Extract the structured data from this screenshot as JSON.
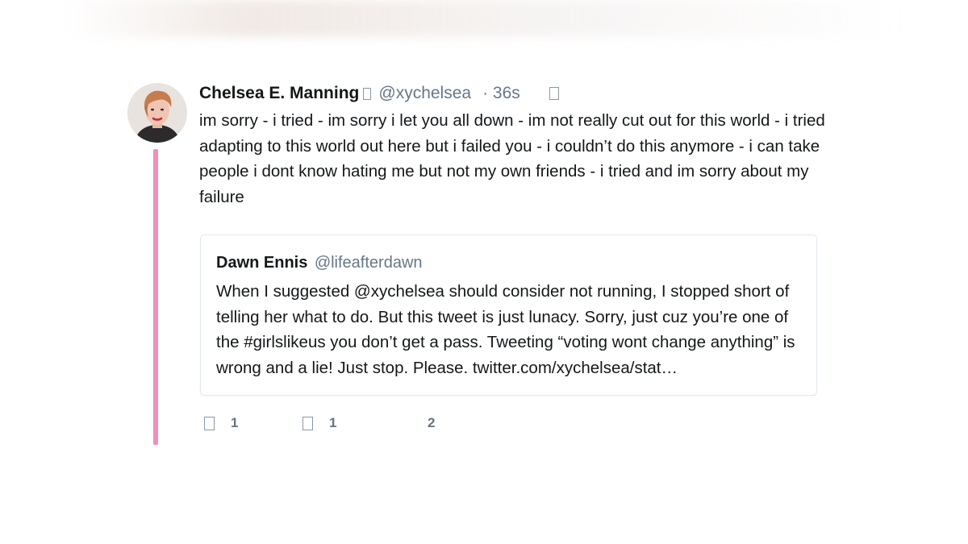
{
  "tweet": {
    "author_name": "Chelsea E. Manning",
    "verified_glyph": "□",
    "handle": "@xychelsea",
    "time": "· 36s",
    "menu_icon": "caret-down-icon",
    "text": "im sorry - i tried - im sorry i let you all down - im not really cut out for this world - i tried adapting to this world out here but i failed you - i couldn’t do this anymore - i can take people i dont know hating me but not my own friends - i tried and im sorry about my failure"
  },
  "quoted_tweet": {
    "author_name": "Dawn Ennis",
    "handle": "@lifeafterdawn",
    "text": "When I suggested @xychelsea should consider not running, I stopped short of telling her what to do. But this tweet is just lunacy. Sorry, just cuz you’re one of the #girlslikeus you don’t get a pass. Tweeting “voting wont change anything” is wrong and a lie! Just stop. Please. twitter.com/xychelsea/stat…"
  },
  "actions": {
    "reply_icon": "reply-icon",
    "reply_count": "1",
    "retweet_icon": "retweet-icon",
    "retweet_count": "1",
    "like_count": "2"
  },
  "colors": {
    "thread_line": "#f08fb8",
    "text_primary": "#14171a",
    "text_secondary": "#657786",
    "quote_border": "#e1e8ed"
  }
}
